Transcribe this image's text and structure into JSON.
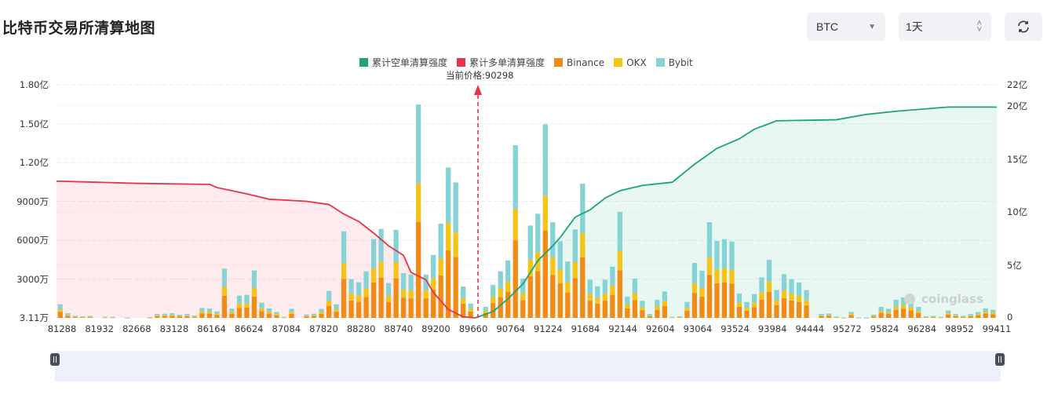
{
  "header": {
    "title": "比特币交易所清算地图",
    "coin_select": "BTC",
    "period_select": "1天",
    "refresh_icon": "refresh-icon"
  },
  "colors": {
    "binance": "#f28a14",
    "okx": "#f6c416",
    "bybit": "#86d3d5",
    "long": "#e8334a",
    "short": "#1aa57a"
  },
  "chart_data": {
    "type": "bar",
    "legend": [
      "累计空单清算强度",
      "累计多单清算强度",
      "Binance",
      "OKX",
      "Bybit"
    ],
    "legend_position": "top-center",
    "current_price_label": "当前价格:90298",
    "current_price": 90298,
    "categories": [
      "81288",
      "81932",
      "82668",
      "83128",
      "86164",
      "86624",
      "87084",
      "87820",
      "88280",
      "88740",
      "89200",
      "89660",
      "90764",
      "91224",
      "91684",
      "92144",
      "92604",
      "93064",
      "93524",
      "93984",
      "94444",
      "95272",
      "95824",
      "96284",
      "98952",
      "99411"
    ],
    "left_axis": {
      "ticks": [
        "1.80亿",
        "1.50亿",
        "1.20亿",
        "9000万",
        "6000万",
        "3000万",
        "3.11万"
      ],
      "unit": "万",
      "ylim": [
        3.11,
        18000
      ]
    },
    "right_axis": {
      "ticks": [
        "22亿",
        "20亿",
        "15亿",
        "10亿",
        "5亿",
        "0"
      ],
      "unit": "亿",
      "ylim": [
        0,
        22
      ]
    },
    "bar_totals_wan": [
      1050,
      360,
      160,
      120,
      160,
      0,
      80,
      80,
      0,
      20,
      0,
      0,
      60,
      300,
      320,
      360,
      240,
      300,
      180,
      770,
      730,
      500,
      3800,
      710,
      1720,
      1780,
      3660,
      1170,
      730,
      450,
      80,
      690,
      0,
      260,
      320,
      690,
      2080,
      1050,
      6690,
      2990,
      2750,
      3600,
      6080,
      6870,
      2690,
      6790,
      3450,
      3350,
      16480,
      3350,
      4850,
      7270,
      11610,
      10460,
      2420,
      1110,
      0,
      850,
      2550,
      3600,
      4440,
      13330,
      3030,
      7130,
      8040,
      14950,
      7390,
      5920,
      4360,
      6830,
      10370,
      2950,
      2440,
      2950,
      3960,
      8180,
      1640,
      3030,
      1320,
      300,
      1390,
      2040,
      80,
      120,
      1230,
      4240,
      3640,
      7390,
      5940,
      6080,
      5900,
      1880,
      1230,
      1840,
      3130,
      4480,
      2160,
      3370,
      2990,
      2730,
      2140,
      0,
      300,
      340,
      100,
      20,
      460,
      20,
      20,
      240,
      850,
      690,
      1390,
      1580,
      1310,
      850,
      120,
      160,
      80,
      570,
      300,
      160,
      300,
      450,
      730,
      630
    ],
    "series": [
      {
        "name": "Binance",
        "share": 0.45
      },
      {
        "name": "OKX",
        "share": 0.18
      },
      {
        "name": "Bybit",
        "share": 0.37
      }
    ],
    "long_cumulative_yi": [
      [
        0,
        12.9
      ],
      [
        10,
        12.7
      ],
      [
        20,
        12.6
      ],
      [
        21,
        12.3
      ],
      [
        25,
        11.7
      ],
      [
        28,
        11.2
      ],
      [
        33,
        11.0
      ],
      [
        36,
        10.7
      ],
      [
        38,
        9.8
      ],
      [
        40,
        9.1
      ],
      [
        42,
        8.0
      ],
      [
        44,
        6.8
      ],
      [
        46,
        5.9
      ],
      [
        47,
        4.3
      ],
      [
        49,
        3.6
      ],
      [
        50,
        2.4
      ],
      [
        52,
        0.8
      ],
      [
        54,
        0.1
      ],
      [
        55.6,
        0
      ]
    ],
    "short_cumulative_yi": [
      [
        55.6,
        0
      ],
      [
        58,
        0.6
      ],
      [
        60,
        1.8
      ],
      [
        62,
        3.2
      ],
      [
        64,
        5.4
      ],
      [
        66,
        6.8
      ],
      [
        67,
        7.6
      ],
      [
        69,
        9.5
      ],
      [
        71,
        10.2
      ],
      [
        73,
        11.3
      ],
      [
        75,
        12.0
      ],
      [
        78,
        12.5
      ],
      [
        82,
        12.8
      ],
      [
        85,
        14.5
      ],
      [
        88,
        16.0
      ],
      [
        91,
        16.9
      ],
      [
        93,
        17.8
      ],
      [
        96,
        18.6
      ],
      [
        104,
        18.7
      ],
      [
        108,
        19.2
      ],
      [
        112,
        19.5
      ],
      [
        119,
        19.9
      ]
    ]
  }
}
